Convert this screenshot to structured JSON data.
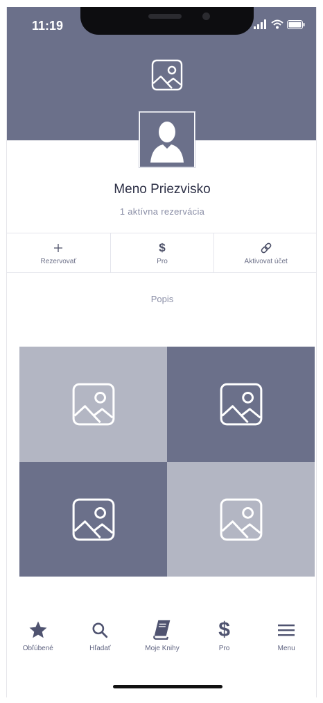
{
  "status": {
    "time": "11:19"
  },
  "profile": {
    "name": "Meno Priezvisko",
    "subtitle": "1 aktívna rezervácia"
  },
  "actions": [
    {
      "icon": "plus-icon",
      "label": "Rezervovať"
    },
    {
      "icon": "dollar-icon",
      "label": "Pro"
    },
    {
      "icon": "link-icon",
      "label": "Aktivovat účet"
    }
  ],
  "section": {
    "title": "Popis"
  },
  "gallery": [
    {
      "tone": "light",
      "icon": "image-placeholder-icon"
    },
    {
      "tone": "dark",
      "icon": "image-placeholder-icon"
    },
    {
      "tone": "dark",
      "icon": "image-placeholder-icon"
    },
    {
      "tone": "light",
      "icon": "image-placeholder-icon"
    }
  ],
  "tabs": [
    {
      "icon": "star-icon",
      "label": "Obľúbené"
    },
    {
      "icon": "search-icon",
      "label": "Hľadať"
    },
    {
      "icon": "book-icon",
      "label": "Moje Knihy"
    },
    {
      "icon": "dollar-icon",
      "label": "Pro"
    },
    {
      "icon": "menu-icon",
      "label": "Menu"
    }
  ],
  "colors": {
    "primary": "#6b708a",
    "light": "#b3b6c3",
    "accent": "#3a3d52"
  }
}
